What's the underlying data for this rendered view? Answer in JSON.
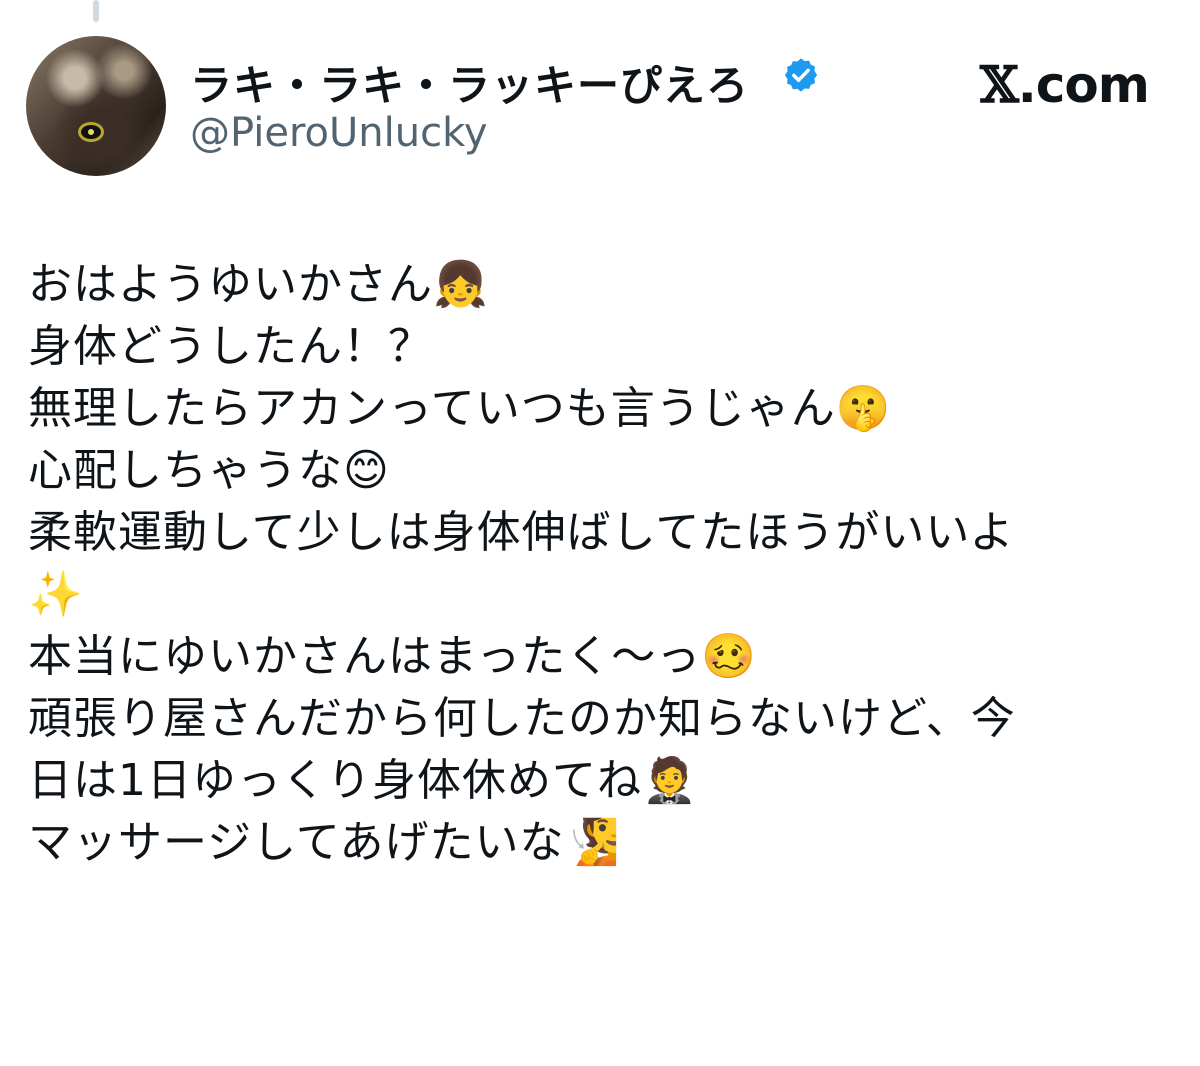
{
  "author": {
    "display_name": "ラキ・ラキ・ラッキーぴえろ",
    "handle": "@PieroUnlucky",
    "verified_icon": "verified-badge-icon",
    "badge_color": "#1d9bf0"
  },
  "brand": {
    "x_glyph": "𝕏",
    "domain": ".com"
  },
  "tweet": {
    "lines": [
      "おはようゆいかさん👧",
      "身体どうしたん！？",
      "無理したらアカンっていつも言うじゃん🤫",
      "心配しちゃうな😊",
      "柔軟運動して少しは身体伸ばしてたほうがいいよ",
      "✨",
      "本当にゆいかさんはまったく〜っ🥴",
      "頑張り屋さんだから何したのか知らないけど、今",
      "日は1日ゆっくり身体休めてね🤵",
      "マッサージしてあげたいな🧏"
    ]
  }
}
